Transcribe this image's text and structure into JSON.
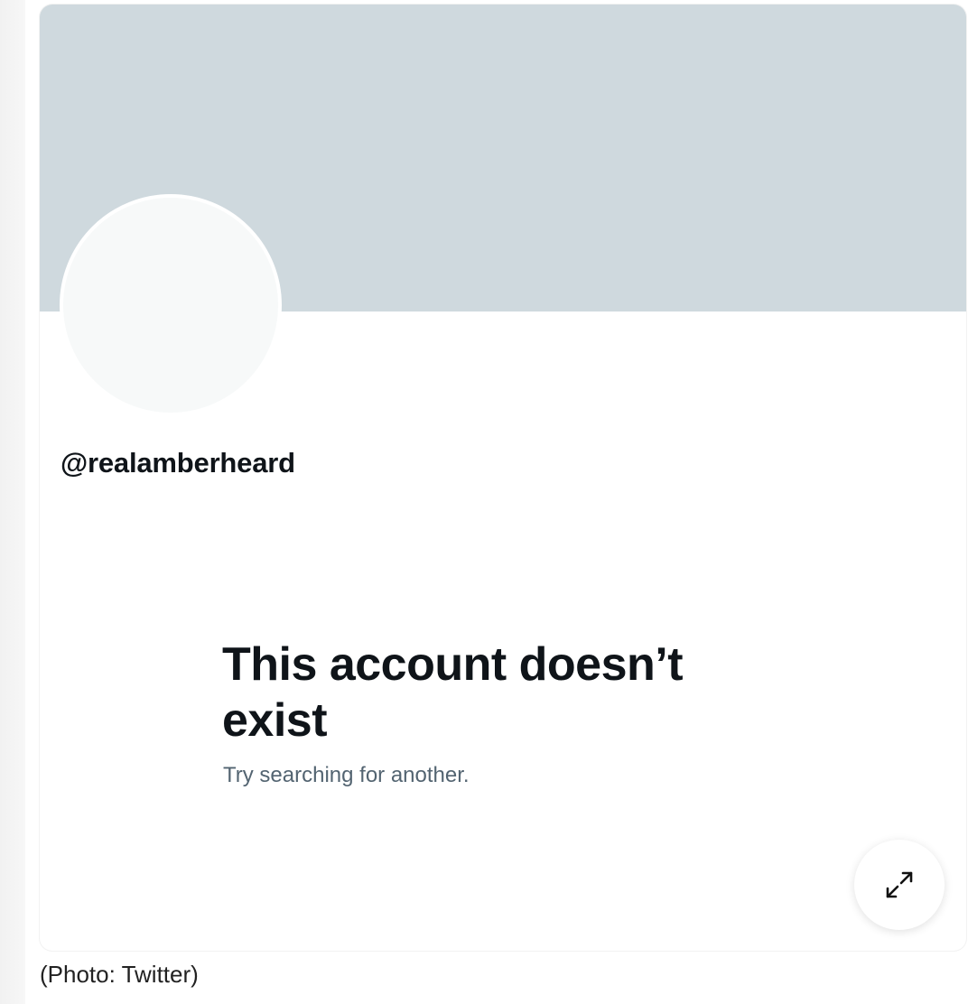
{
  "profile": {
    "handle": "@realamberheard",
    "banner_color": "#cfd9de",
    "avatar_color": "#f7f9f9"
  },
  "notice": {
    "title": "This account doesn’t exist",
    "subtitle": "Try searching for another."
  },
  "expand_button": {
    "icon": "expand-arrows-icon"
  },
  "caption": "(Photo: Twitter)"
}
